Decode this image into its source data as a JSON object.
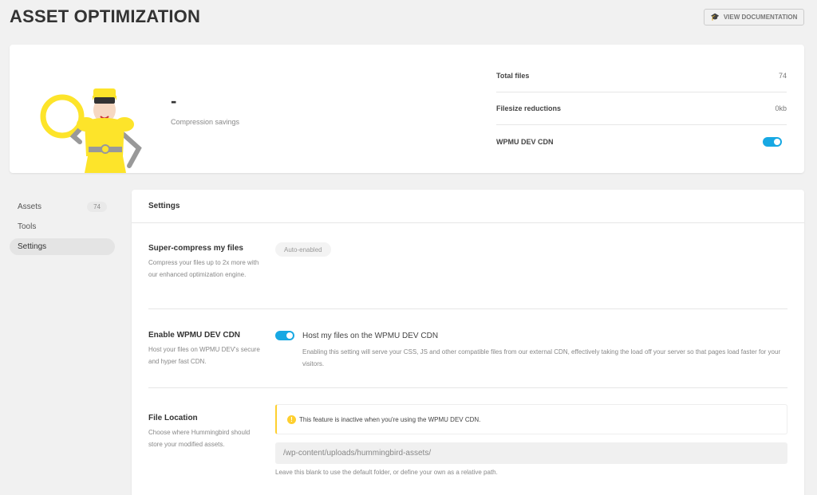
{
  "header": {
    "title": "ASSET OPTIMIZATION",
    "doc_button": "VIEW DOCUMENTATION",
    "doc_icon": "graduation-cap-icon"
  },
  "summary": {
    "savings_value": "-",
    "savings_label": "Compression savings",
    "stats": [
      {
        "label": "Total files",
        "value": "74"
      },
      {
        "label": "Filesize reductions",
        "value": "0kb"
      },
      {
        "label": "WPMU DEV CDN",
        "toggle": true
      }
    ]
  },
  "sidebar": {
    "items": [
      {
        "label": "Assets",
        "count": "74"
      },
      {
        "label": "Tools"
      },
      {
        "label": "Settings",
        "active": true
      }
    ]
  },
  "settings": {
    "title": "Settings",
    "super_compress": {
      "title": "Super-compress my files",
      "desc": "Compress your files up to 2x more with our enhanced optimization engine.",
      "badge": "Auto-enabled"
    },
    "cdn": {
      "title": "Enable WPMU DEV CDN",
      "desc": "Host your files on WPMU DEV's secure and hyper fast CDN.",
      "toggle_label": "Host my files on the WPMU DEV CDN",
      "toggle_on": true,
      "explanation": "Enabling this setting will serve your CSS, JS and other compatible files from our external CDN, effectively taking the load off your server so that pages load faster for your visitors."
    },
    "file_location": {
      "title": "File Location",
      "desc": "Choose where Hummingbird should store your modified assets.",
      "notice": "This feature is inactive when you're using the WPMU DEV CDN.",
      "path_value": "/wp-content/uploads/hummingbird-assets/",
      "help": "Leave this blank to use the default folder, or define your own as a relative path."
    }
  },
  "colors": {
    "accent": "#17a8e3",
    "warning": "#fecf2f",
    "background": "#f1f1f1"
  }
}
